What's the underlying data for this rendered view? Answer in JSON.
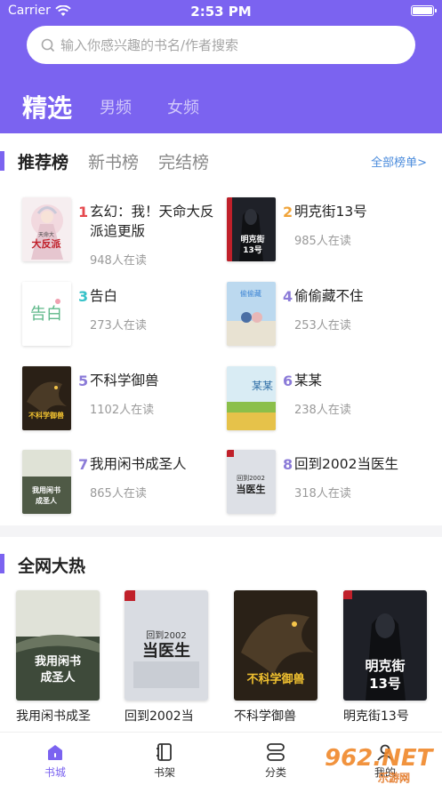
{
  "status": {
    "carrier": "Carrier",
    "time": "2:53 PM"
  },
  "search": {
    "placeholder": "输入你感兴趣的书名/作者搜索"
  },
  "channels": [
    {
      "label": "精选",
      "active": true
    },
    {
      "label": "男频",
      "active": false
    },
    {
      "label": "女频",
      "active": false
    }
  ],
  "rank": {
    "tabs": [
      {
        "label": "推荐榜",
        "active": true
      },
      {
        "label": "新书榜",
        "active": false
      },
      {
        "label": "完结榜",
        "active": false
      }
    ],
    "all_link": "全部榜单>",
    "items": [
      {
        "num": "1",
        "title": "玄幻：我！天命大反派追更版",
        "readers": "948人在读",
        "num_color": "#e5484d"
      },
      {
        "num": "2",
        "title": "明克街13号",
        "readers": "985人在读",
        "num_color": "#f0a43a"
      },
      {
        "num": "3",
        "title": "告白",
        "readers": "273人在读",
        "num_color": "#36c2c8"
      },
      {
        "num": "4",
        "title": "偷偷藏不住",
        "readers": "253人在读",
        "num_color": "#8b7bd8"
      },
      {
        "num": "5",
        "title": "不科学御兽",
        "readers": "1102人在读",
        "num_color": "#8b7bd8"
      },
      {
        "num": "6",
        "title": "某某",
        "readers": "238人在读",
        "num_color": "#8b7bd8"
      },
      {
        "num": "7",
        "title": "我用闲书成圣人",
        "readers": "865人在读",
        "num_color": "#8b7bd8"
      },
      {
        "num": "8",
        "title": "回到2002当医生",
        "readers": "318人在读",
        "num_color": "#8b7bd8"
      }
    ]
  },
  "hot": {
    "title": "全网大热",
    "items": [
      {
        "name": "我用闲书成圣"
      },
      {
        "name": "回到2002当"
      },
      {
        "name": "不科学御兽"
      },
      {
        "name": "明克街13号"
      }
    ]
  },
  "tabbar": [
    {
      "label": "书城",
      "icon": "home-icon",
      "active": true
    },
    {
      "label": "书架",
      "icon": "bookshelf-icon",
      "active": false
    },
    {
      "label": "分类",
      "icon": "category-icon",
      "active": false
    },
    {
      "label": "我的",
      "icon": "profile-icon",
      "active": false
    }
  ],
  "watermark": {
    "text": "962.NET",
    "sub": "乐游网"
  },
  "colors": {
    "accent": "#7b63f0",
    "link": "#4a8bdc"
  },
  "covers": {
    "c1_a": "大反派",
    "c1_b": "天命大",
    "c2_a": "明克街",
    "c2_b": "13号",
    "c3_a": "告白",
    "c4_a": "偷偷藏",
    "c5_a": "不科学御兽",
    "c6_a": "某某",
    "c7_a": "我用闲书",
    "c7_b": "成圣人",
    "c8_a": "回到2002",
    "c8_b": "当医生"
  }
}
